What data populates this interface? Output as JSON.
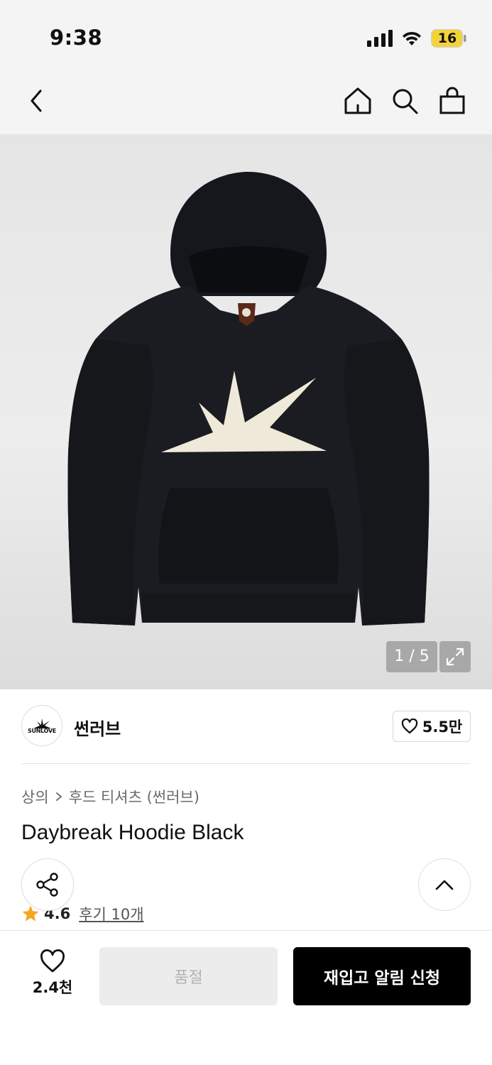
{
  "status_bar": {
    "time": "9:38",
    "battery": "16"
  },
  "nav": {
    "icons": [
      "back-icon",
      "home-icon",
      "search-icon",
      "bag-icon"
    ]
  },
  "gallery": {
    "counter": "1 / 5",
    "current": 1,
    "total": 5
  },
  "brand": {
    "logo_text": "SUNLOVE",
    "name": "썬러브",
    "likes": "5.5만"
  },
  "breadcrumb": {
    "category": "상의",
    "subcategory": "후드 티셔츠 (썬러브)"
  },
  "product": {
    "title": "Daybreak Hoodie Black",
    "rating": "4.6",
    "reviews": "후기 10개"
  },
  "bottom_bar": {
    "wish_count": "2.4천",
    "soldout_label": "품절",
    "restock_label": "재입고 알림 신청"
  },
  "colors": {
    "accent_star": "#f5a623",
    "primary_button": "#000000",
    "disabled_button": "#ececec"
  }
}
